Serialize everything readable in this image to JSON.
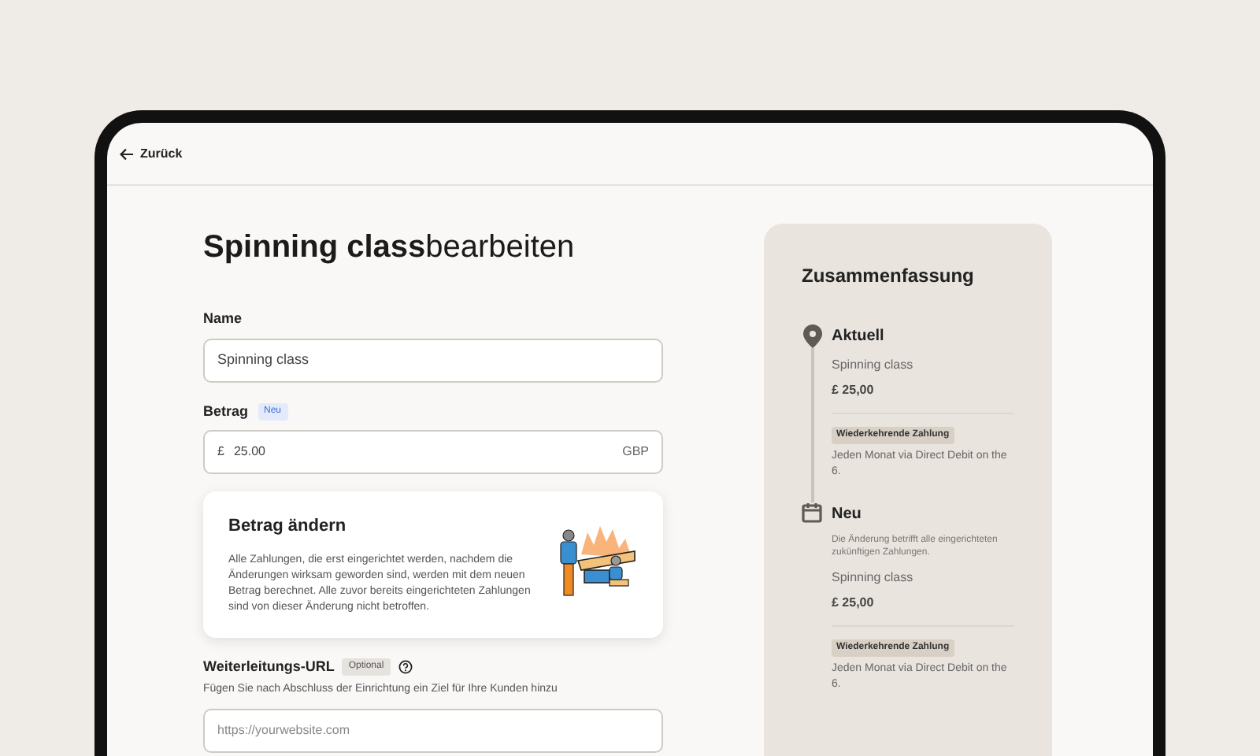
{
  "header": {
    "back_link": "Zurück"
  },
  "title": {
    "bold": "Spinning class",
    "rest": "bearbeiten"
  },
  "name_field": {
    "label": "Name",
    "value": "Spinning class"
  },
  "amount_field": {
    "label": "Betrag",
    "badge": "Neu",
    "currency_symbol": "£",
    "value": "25.00",
    "currency": "GBP"
  },
  "info_card": {
    "title": "Betrag ändern",
    "text": "Alle Zahlungen, die erst eingerichtet werden, nachdem die Änderungen wirksam geworden sind, werden mit dem neuen Betrag berechnet. Alle zuvor bereits eingerichteten Zahlungen sind von dieser Änderung nicht betroffen."
  },
  "redirect_field": {
    "label": "Weiterleitungs-URL",
    "badge": "Optional",
    "hint": "Fügen Sie nach Abschluss der Einrichtung ein Ziel für Ihre Kunden hinzu",
    "placeholder": "https://yourwebsite.com"
  },
  "summary": {
    "title": "Zusammenfassung",
    "steps": [
      {
        "kind": "pin",
        "title": "Aktuell",
        "name": "Spinning class",
        "amount": "£ 25,00",
        "tag": "Wiederkehrende Zahlung",
        "schedule": "Jeden Monat via Direct Debit on the 6."
      },
      {
        "kind": "calendar",
        "title": "Neu",
        "note": "Die Änderung betrifft alle eingerichteten zukünftigen Zahlungen.",
        "name": "Spinning class",
        "amount": "£ 25,00",
        "tag": "Wiederkehrende Zahlung",
        "schedule": "Jeden Monat via Direct Debit on the 6."
      }
    ]
  }
}
